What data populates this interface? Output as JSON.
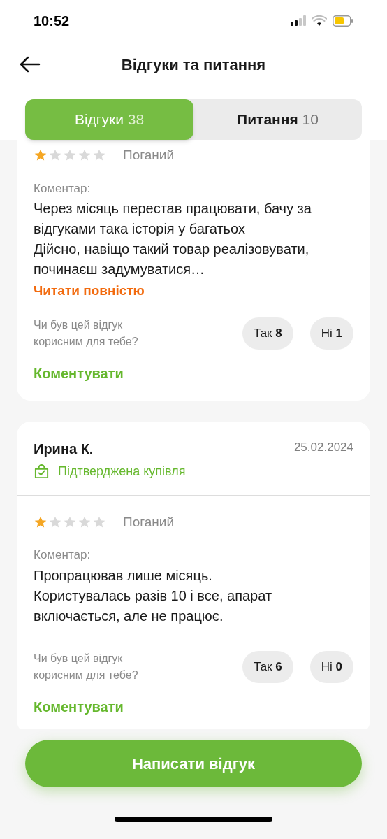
{
  "status_bar": {
    "time": "10:52"
  },
  "header": {
    "title": "Відгуки та питання"
  },
  "tabs": [
    {
      "label": "Відгуки",
      "count": "38",
      "selected": true
    },
    {
      "label": "Питання",
      "count": "10",
      "selected": false
    }
  ],
  "reviews": [
    {
      "stars": 1,
      "rating_label": "Поганий",
      "comment_label": "Коментар:",
      "comment": "Через місяць перестав працювати, бачу за відгуками така історія у багатьох\nДійсно, навіщо такий товар реалізовувати, починаєш задумуватися…",
      "read_more": "Читати повністю",
      "helpful_question": "Чи був цей відгук корисним для тебе?",
      "yes": {
        "label": "Так",
        "count": "8"
      },
      "no": {
        "label": "Ні",
        "count": "1"
      },
      "comment_action": "Коментувати"
    },
    {
      "author": "Ирина К.",
      "date": "25.02.2024",
      "verified": "Підтверджена купівля",
      "stars": 1,
      "rating_label": "Поганий",
      "comment_label": "Коментар:",
      "comment": "Пропрацював лише місяць.\nКористувалась разів 10 і все, апарат включається, але не працює.",
      "helpful_question": "Чи був цей відгук корисним для тебе?",
      "yes": {
        "label": "Так",
        "count": "6"
      },
      "no": {
        "label": "Ні",
        "count": "0"
      },
      "comment_action": "Коментувати"
    }
  ],
  "write_button": {
    "label": "Написати відгук"
  }
}
